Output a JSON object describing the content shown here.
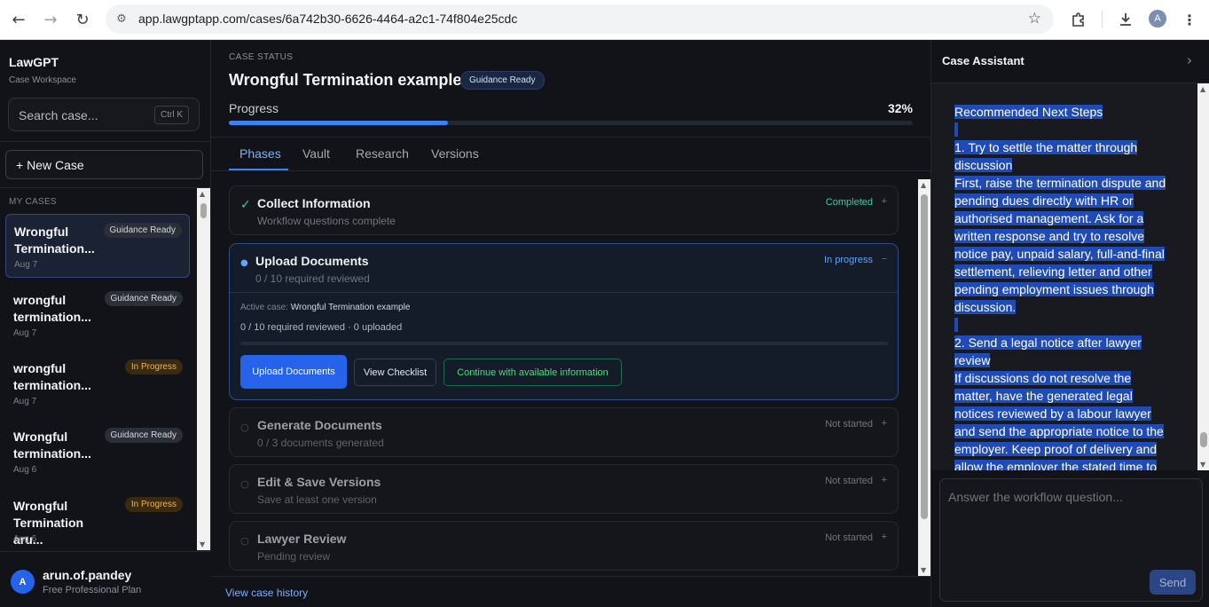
{
  "browser": {
    "url": "app.lawgptapp.com/cases/6a742b30-6626-4464-a2c1-74f804e25cdc",
    "profile_initial": "A"
  },
  "sidebar": {
    "brand": "LawGPT",
    "subtitle": "Case Workspace",
    "search_placeholder": "Search case...",
    "search_shortcut": "Ctrl K",
    "new_case_label": "+ New Case",
    "section_label": "MY CASES",
    "cases": [
      {
        "title": "Wrongful Termination...",
        "badge": "Guidance Ready",
        "date": "Aug 7"
      },
      {
        "title": "wrongful termination...",
        "badge": "Guidance Ready",
        "date": "Aug 7"
      },
      {
        "title": "wrongful termination...",
        "badge": "In Progress",
        "date": "Aug 7"
      },
      {
        "title": "Wrongful termination...",
        "badge": "Guidance Ready",
        "date": "Aug 6"
      },
      {
        "title": "Wrongful Termination aru...",
        "badge": "In Progress",
        "date": "Aug 6"
      }
    ],
    "user": {
      "initial": "A",
      "name": "arun.of.pandey",
      "plan": "Free Professional Plan"
    }
  },
  "main": {
    "status_label": "CASE STATUS",
    "case_title": "Wrongful Termination example",
    "case_badge": "Guidance Ready",
    "progress_label": "Progress",
    "progress_text": "32%",
    "progress_value": 0.32,
    "tabs": [
      {
        "label": "Phases"
      },
      {
        "label": "Vault"
      },
      {
        "label": "Research"
      },
      {
        "label": "Versions"
      }
    ],
    "phases": [
      {
        "title": "Collect Information",
        "subtitle": "Workflow questions complete",
        "state": "Completed",
        "toggle": "+"
      },
      {
        "title": "Upload Documents",
        "subtitle": "0 / 10 required reviewed",
        "state": "In progress",
        "toggle": "−"
      },
      {
        "title": "Generate Documents",
        "subtitle": "0 / 3 documents generated",
        "state": "Not started",
        "toggle": "+"
      },
      {
        "title": "Edit & Save Versions",
        "subtitle": "Save at least one version",
        "state": "Not started",
        "toggle": "+"
      },
      {
        "title": "Lawyer Review",
        "subtitle": "Pending review",
        "state": "Not started",
        "toggle": "+"
      }
    ],
    "upload_panel": {
      "active_case_label": "Active case:",
      "active_case_name": "Wrongful Termination example",
      "requirement_line": "0 / 10 required reviewed · 0 uploaded",
      "upload_button": "Upload Documents",
      "checklist_button": "View Checklist",
      "continue_button": "Continue with available information"
    },
    "history_link": "View case history"
  },
  "assistant": {
    "title": "Case Assistant",
    "lines": [
      "Recommended Next Steps",
      "",
      "1. Try to settle the matter through",
      "discussion",
      "First, raise the termination dispute and",
      "pending dues directly with HR or",
      "authorised management. Ask for a",
      "written response and try to resolve",
      "notice pay, unpaid salary, full-and-final",
      "settlement, relieving letter and other",
      "pending employment issues through",
      "discussion.",
      "",
      "2. Send a legal notice after lawyer",
      "review",
      "If discussions do not resolve the",
      "matter, have the generated legal",
      "notices reviewed by a labour lawyer",
      "and send the appropriate notice to the",
      "employer. Keep proof of delivery and",
      "allow the employer the stated time to"
    ],
    "input_placeholder": "Answer the workflow question...",
    "send_label": "Send"
  }
}
